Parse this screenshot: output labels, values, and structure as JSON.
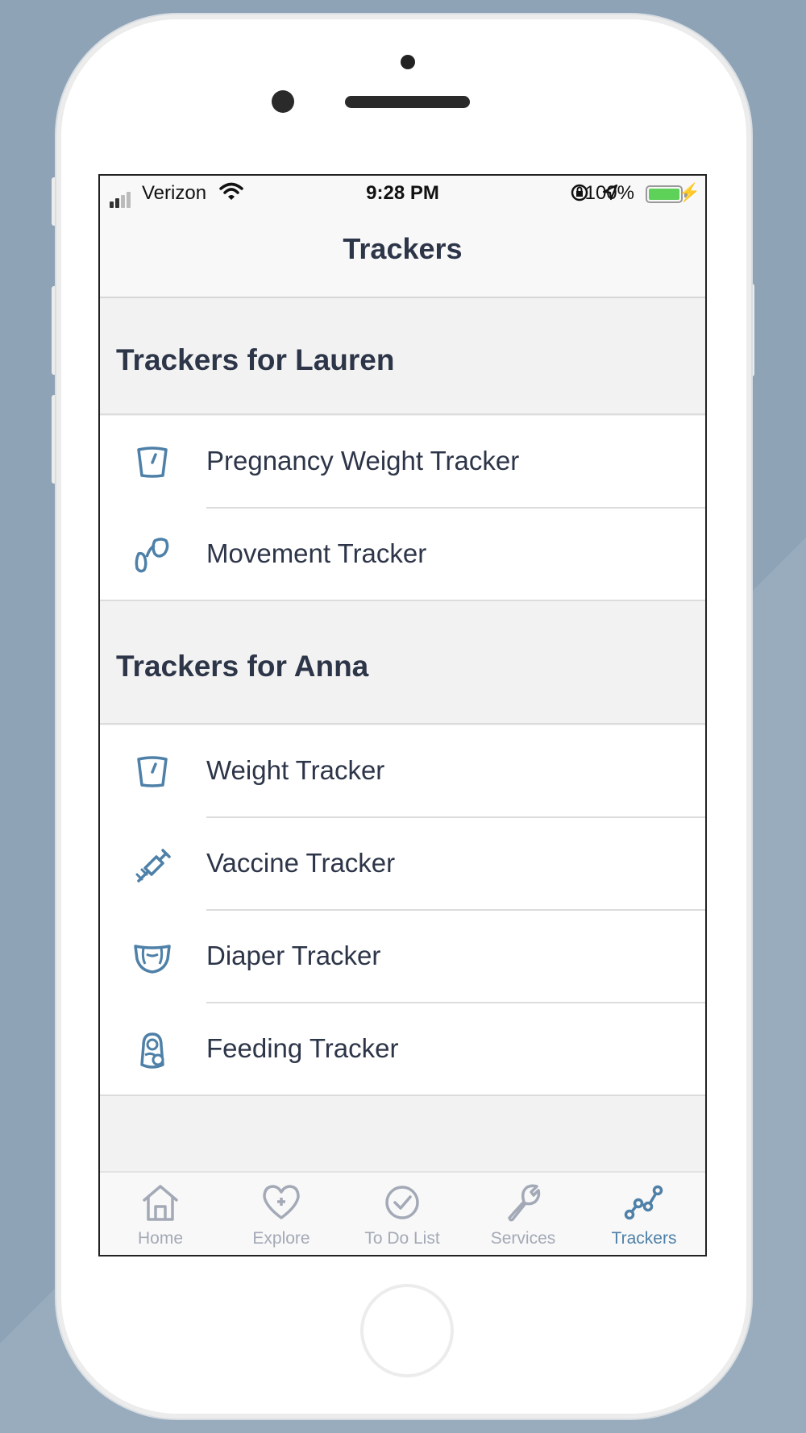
{
  "status_bar": {
    "carrier": "Verizon",
    "time": "9:28 PM",
    "battery": "100%"
  },
  "nav": {
    "title": "Trackers"
  },
  "sections": [
    {
      "title": "Trackers for Lauren",
      "items": [
        {
          "label": "Pregnancy Weight Tracker",
          "icon": "scale-icon"
        },
        {
          "label": "Movement Tracker",
          "icon": "footprints-icon"
        }
      ]
    },
    {
      "title": "Trackers for Anna",
      "items": [
        {
          "label": "Weight Tracker",
          "icon": "scale-icon"
        },
        {
          "label": "Vaccine Tracker",
          "icon": "syringe-icon"
        },
        {
          "label": "Diaper Tracker",
          "icon": "diaper-icon"
        },
        {
          "label": "Feeding Tracker",
          "icon": "baby-bottle-icon"
        }
      ]
    }
  ],
  "tab_bar": {
    "tabs": [
      {
        "label": "Home",
        "icon": "home-icon"
      },
      {
        "label": "Explore",
        "icon": "heart-plus-icon"
      },
      {
        "label": "To Do List",
        "icon": "check-circle-icon"
      },
      {
        "label": "Services",
        "icon": "wrench-icon"
      },
      {
        "label": "Trackers",
        "icon": "trackers-graph-icon"
      }
    ],
    "active": "Trackers"
  },
  "colors": {
    "accent": "#4e80a8",
    "text": "#2d3548",
    "inactive_tab": "#a3a9b6",
    "section_bg": "#f2f2f2",
    "background": "#8ea3b6"
  }
}
